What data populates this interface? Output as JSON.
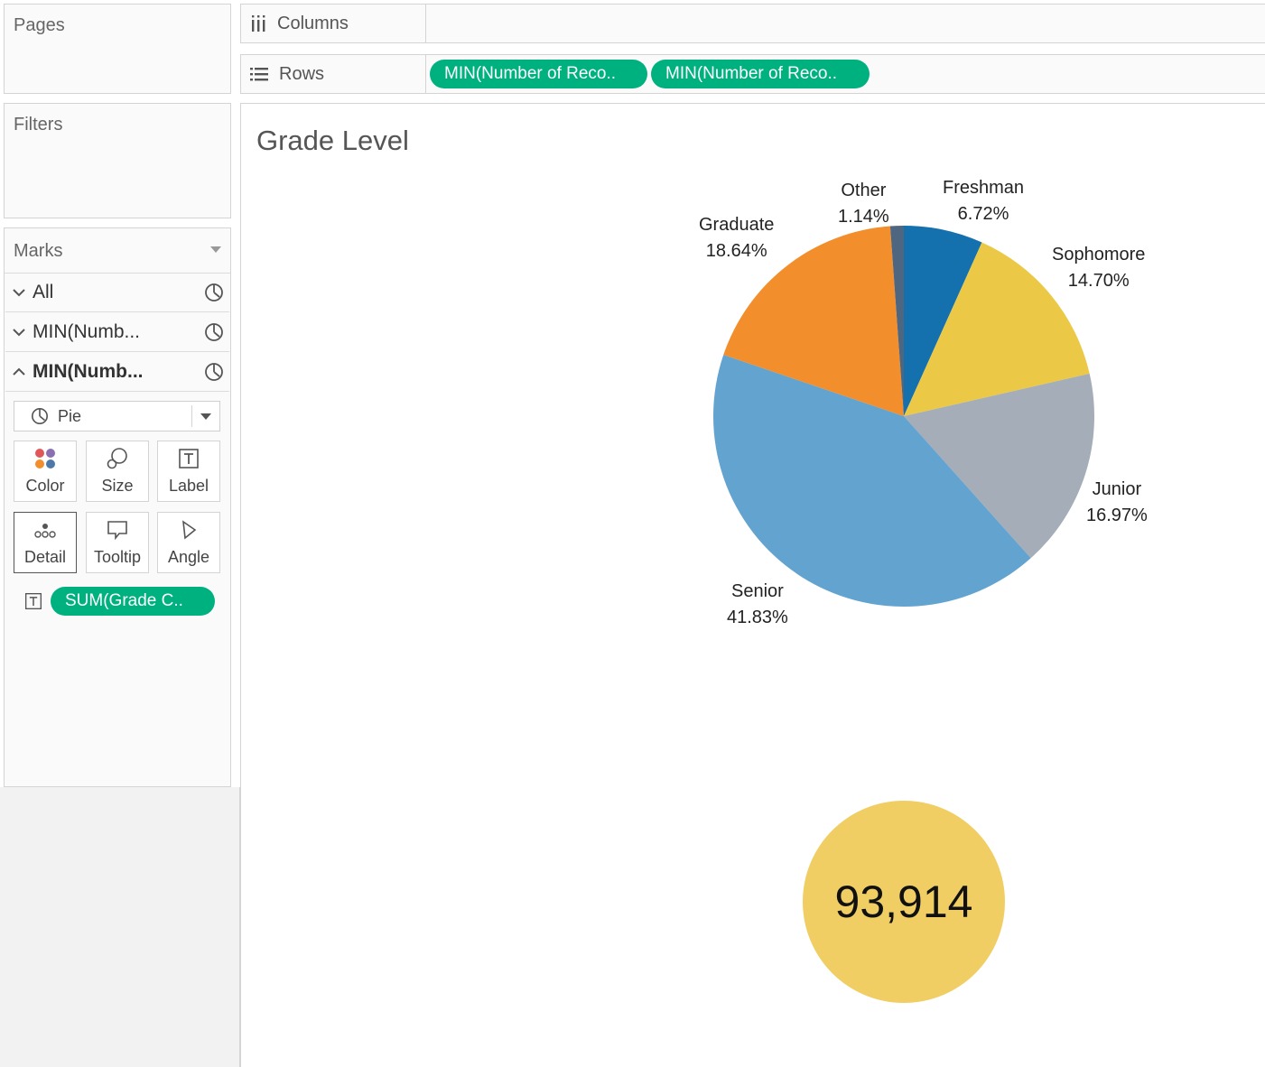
{
  "left_panel": {
    "pages_title": "Pages",
    "filters_title": "Filters",
    "marks": {
      "title": "Marks",
      "layers": [
        {
          "label": "All",
          "expanded": false
        },
        {
          "label": "MIN(Numb...",
          "expanded": false
        },
        {
          "label": "MIN(Numb...",
          "expanded": true,
          "bold": true
        }
      ],
      "mark_type": "Pie",
      "buttons": [
        "Color",
        "Size",
        "Label",
        "Detail",
        "Tooltip",
        "Angle"
      ],
      "label_pill": "SUM(Grade C.."
    }
  },
  "shelves": {
    "columns_label": "Columns",
    "rows_label": "Rows",
    "row_pills": [
      "MIN(Number of Reco..",
      "MIN(Number of Reco.."
    ]
  },
  "sheet": {
    "title": "Grade Level",
    "total": "93,914"
  },
  "colors": {
    "pill": "#00b180",
    "bubble": "#f0ce63"
  },
  "chart_data": {
    "type": "pie",
    "title": "Grade Level",
    "slices": [
      {
        "label": "Freshman",
        "value_text": "6.72%",
        "value": 6.72,
        "color": "#1570ae"
      },
      {
        "label": "Sophomore",
        "value_text": "14.70%",
        "value": 14.7,
        "color": "#ebc946"
      },
      {
        "label": "Junior",
        "value_text": "16.97%",
        "value": 16.97,
        "color": "#a4adb8"
      },
      {
        "label": "Senior",
        "value_text": "41.83%",
        "value": 41.83,
        "color": "#62a3d0"
      },
      {
        "label": "Graduate",
        "value_text": "18.64%",
        "value": 18.64,
        "color": "#f28e2b"
      },
      {
        "label": "Other",
        "value_text": "1.14%",
        "value": 1.14,
        "color": "#4f6680"
      }
    ]
  }
}
